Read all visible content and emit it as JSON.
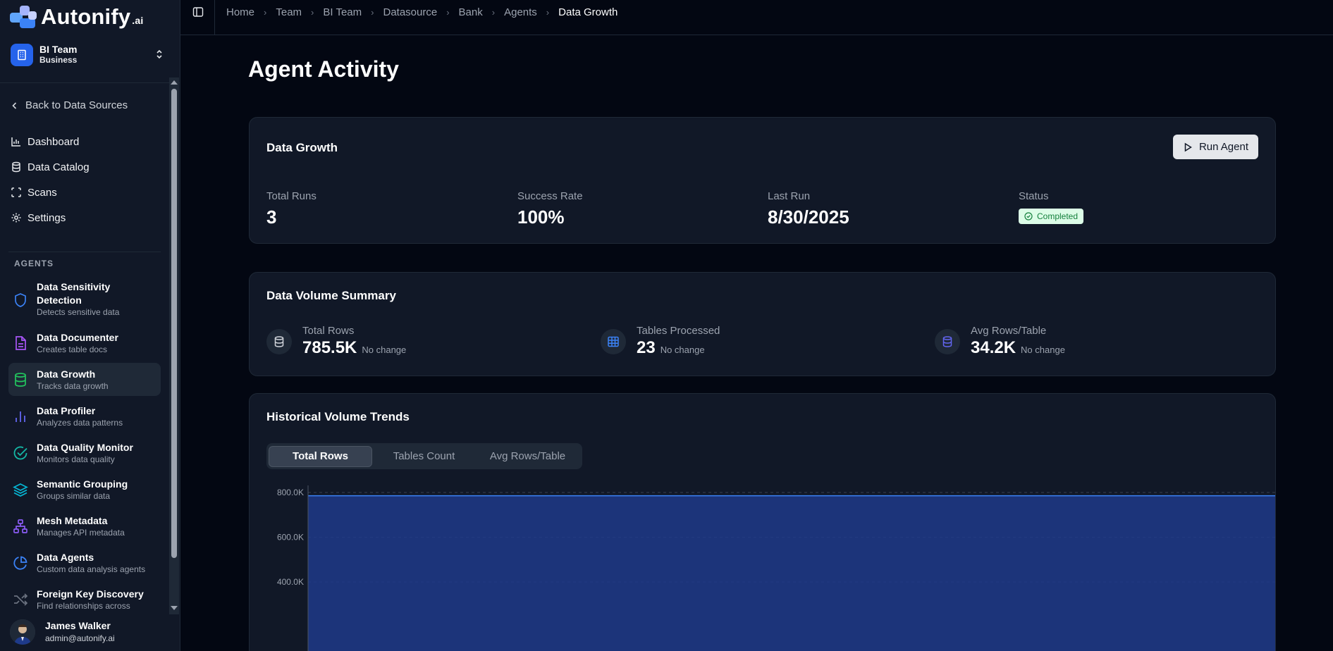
{
  "app": {
    "logo_text": "Autonify",
    "logo_suffix": ".ai"
  },
  "team": {
    "name": "BI Team",
    "plan": "Business"
  },
  "nav": {
    "back_label": "Back to Data Sources",
    "items": [
      {
        "label": "Dashboard",
        "icon": "bar-chart-icon"
      },
      {
        "label": "Data Catalog",
        "icon": "database-icon"
      },
      {
        "label": "Scans",
        "icon": "scan-icon"
      },
      {
        "label": "Settings",
        "icon": "gear-icon"
      }
    ]
  },
  "agents_section": "AGENTS",
  "agents": [
    {
      "title": "Data Sensitivity Detection",
      "desc": "Detects sensitive data",
      "icon": "shield-icon",
      "color": "#3b82f6"
    },
    {
      "title": "Data Documenter",
      "desc": "Creates table docs",
      "icon": "document-icon",
      "color": "#a855f7"
    },
    {
      "title": "Data Growth",
      "desc": "Tracks data growth",
      "icon": "database-icon",
      "color": "#22c55e",
      "active": true
    },
    {
      "title": "Data Profiler",
      "desc": "Analyzes data patterns",
      "icon": "bar-chart-icon",
      "color": "#6366f1"
    },
    {
      "title": "Data Quality Monitor",
      "desc": "Monitors data quality",
      "icon": "check-circle-icon",
      "color": "#14b8a6"
    },
    {
      "title": "Semantic Grouping",
      "desc": "Groups similar data",
      "icon": "layers-icon",
      "color": "#06b6d4"
    },
    {
      "title": "Mesh Metadata",
      "desc": "Manages API metadata",
      "icon": "network-icon",
      "color": "#8b5cf6"
    },
    {
      "title": "Data Agents",
      "desc": "Custom data analysis agents",
      "icon": "pie-chart-icon",
      "color": "#3b82f6"
    },
    {
      "title": "Foreign Key Discovery",
      "desc": "Find relationships across",
      "icon": "shuffle-icon",
      "color": "#6b7280"
    }
  ],
  "user": {
    "name": "James Walker",
    "email": "admin@autonify.ai"
  },
  "breadcrumbs": [
    "Home",
    "Team",
    "BI Team",
    "Datasource",
    "Bank",
    "Agents",
    "Data Growth"
  ],
  "page_title": "Agent Activity",
  "summary": {
    "title": "Data Growth",
    "run_label": "Run Agent",
    "stats": [
      {
        "label": "Total Runs",
        "value": "3"
      },
      {
        "label": "Success Rate",
        "value": "100%"
      },
      {
        "label": "Last Run",
        "value": "8/30/2025"
      }
    ],
    "status_label": "Status",
    "status_value": "Completed"
  },
  "volume": {
    "title": "Data Volume Summary",
    "stats": [
      {
        "label": "Total Rows",
        "value": "785.5K",
        "change": "No change",
        "icon": "database-icon",
        "color": "#9ca3af"
      },
      {
        "label": "Tables Processed",
        "value": "23",
        "change": "No change",
        "icon": "table-icon",
        "color": "#3b82f6"
      },
      {
        "label": "Avg Rows/Table",
        "value": "34.2K",
        "change": "No change",
        "icon": "database-icon",
        "color": "#6366f1"
      }
    ]
  },
  "trends": {
    "title": "Historical Volume Trends",
    "tabs": [
      "Total Rows",
      "Tables Count",
      "Avg Rows/Table"
    ],
    "active_tab": 0
  },
  "chart_data": {
    "type": "area",
    "y_ticks": [
      "800.0K",
      "600.0K",
      "400.0K"
    ],
    "ylim": [
      0,
      800000
    ],
    "values": [
      785500,
      785500
    ],
    "grid": true,
    "fill_color": "#1e3a8a",
    "line_color": "#3b82f6"
  }
}
